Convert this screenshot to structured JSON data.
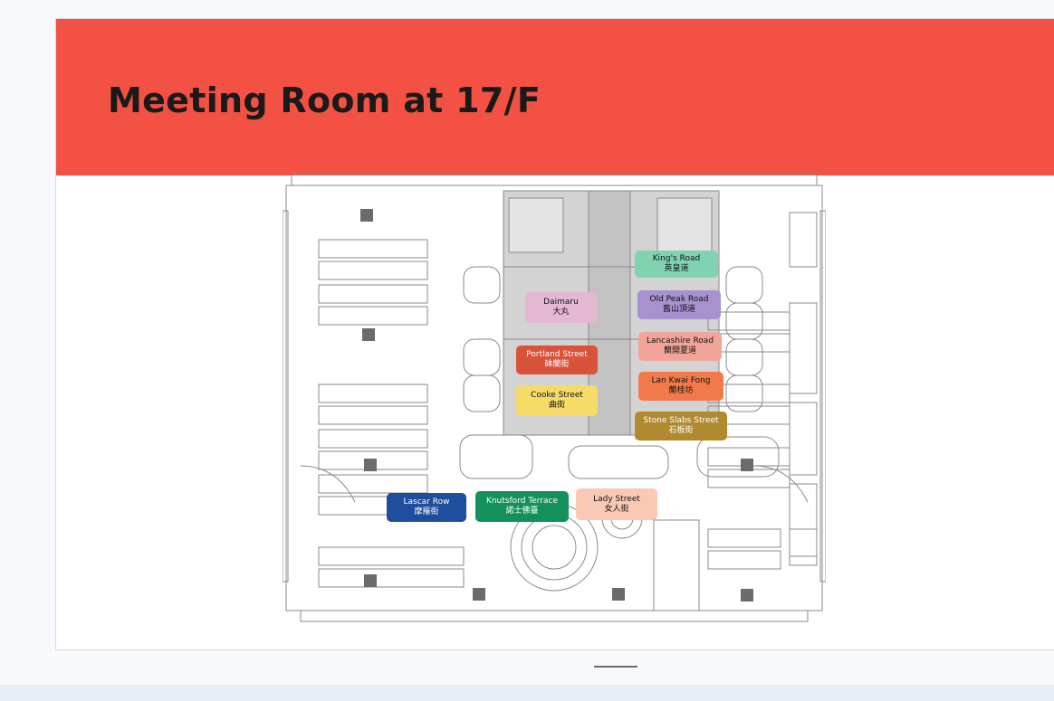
{
  "page": {
    "title": "Meeting Room at 17/F"
  },
  "colors": {
    "header": "#f25143",
    "card": "#ffffff",
    "page_bg": "#f7f9fc"
  },
  "rooms": [
    {
      "id": "kings",
      "name_en": "King's Road",
      "name_zh": "英皇道",
      "color": "#7fd3b0"
    },
    {
      "id": "daimaru",
      "name_en": "Daimaru",
      "name_zh": "大丸",
      "color": "#e4b7d3"
    },
    {
      "id": "oldpeak",
      "name_en": "Old Peak Road",
      "name_zh": "舊山頂道",
      "color": "#a891cf"
    },
    {
      "id": "lancashire",
      "name_en": "Lancashire Road",
      "name_zh": "蘭開夏道",
      "color": "#f3a49a"
    },
    {
      "id": "portland",
      "name_en": "Portland Street",
      "name_zh": "砵蘭街",
      "color": "#d9533b"
    },
    {
      "id": "lkf",
      "name_en": "Lan Kwai Fong",
      "name_zh": "蘭桂坊",
      "color": "#f27a4a"
    },
    {
      "id": "cooke",
      "name_en": "Cooke Street",
      "name_zh": "曲街",
      "color": "#f6db69"
    },
    {
      "id": "stoneslabs",
      "name_en": "Stone Slabs Street",
      "name_zh": "石板街",
      "color": "#b08a2f"
    },
    {
      "id": "lascar",
      "name_en": "Lascar Row",
      "name_zh": "摩羅街",
      "color": "#1f4e9c"
    },
    {
      "id": "knutsford",
      "name_en": "Knutsford Terrace",
      "name_zh": "諾士佛臺",
      "color": "#13915a"
    },
    {
      "id": "ladystreet",
      "name_en": "Lady Street",
      "name_zh": "女人街",
      "color": "#fac9b6"
    }
  ]
}
